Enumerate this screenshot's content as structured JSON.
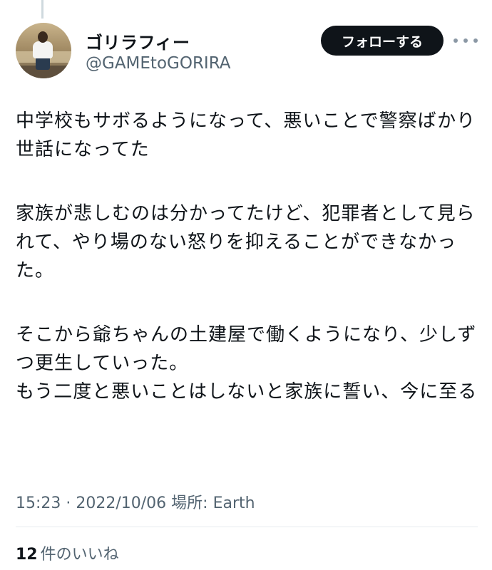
{
  "author": {
    "display_name": "ゴリラフィー",
    "handle": "@GAMEtoGORIRA"
  },
  "actions": {
    "follow_label": "フォローする",
    "more_icon": "more-horizontal-icon"
  },
  "tweet": {
    "paragraph_1": "中学校もサボるようになって、悪いことで警察ばかり世話になってた",
    "paragraph_2": "家族が悲しむのは分かってたけど、犯罪者として見られて、やり場のない怒りを抑えることができなかった。",
    "paragraph_3_line_1": "そこから爺ちゃんの土建屋で働くようになり、少しずつ更生していった。",
    "paragraph_3_line_2": "もう二度と悪いことはしないと家族に誓い、今に至る"
  },
  "meta": {
    "time_date_location": "15:23 · 2022/10/06 場所: Earth"
  },
  "likes": {
    "count": "12",
    "label": "件のいいね"
  },
  "colors": {
    "text_primary": "#0f1419",
    "text_secondary": "#536471",
    "button_bg": "#0f1419",
    "button_text": "#ffffff",
    "divider": "#e6ebee"
  }
}
